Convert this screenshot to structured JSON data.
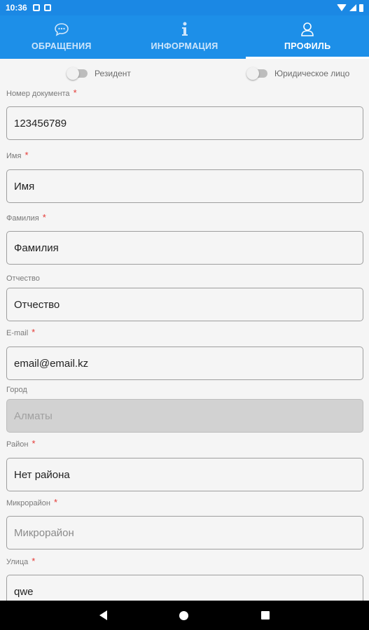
{
  "status_bar": {
    "time": "10:36"
  },
  "tabs": [
    {
      "label": "ОБРАЩЕНИЯ",
      "icon": "chat-bubble-icon",
      "active": false
    },
    {
      "label": "ИНФОРМАЦИЯ",
      "icon": "info-icon",
      "active": false
    },
    {
      "label": "ПРОФИЛЬ",
      "icon": "user-icon",
      "active": true
    }
  ],
  "toggles": {
    "resident": {
      "label": "Резидент",
      "on": false
    },
    "legal_entity": {
      "label": "Юридическое лицо",
      "on": false
    }
  },
  "form": {
    "document_number": {
      "label": "Номер документа",
      "required": true,
      "value": "123456789"
    },
    "first_name": {
      "label": "Имя",
      "required": true,
      "value": "Имя"
    },
    "last_name": {
      "label": "Фамилия",
      "required": true,
      "value": "Фамилия"
    },
    "patronymic": {
      "label": "Отчество",
      "required": false,
      "value": "Отчество"
    },
    "email": {
      "label": "E-mail",
      "required": true,
      "value": "email@email.kz"
    },
    "city": {
      "label": "Город",
      "required": false,
      "value": "Алматы",
      "disabled": true
    },
    "district": {
      "label": "Район",
      "required": true,
      "value": "Нет района"
    },
    "microdistrict": {
      "label": "Микрорайон",
      "required": true,
      "placeholder": "Микрорайон"
    },
    "street": {
      "label": "Улица",
      "required": true,
      "value": "qwe"
    }
  },
  "required_mark": "*",
  "colors": {
    "primary": "#1d8fe8",
    "required": "#e53935"
  }
}
